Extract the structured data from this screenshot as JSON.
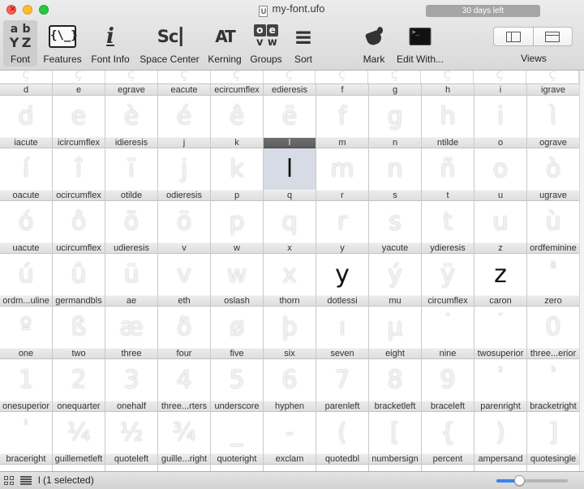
{
  "window": {
    "title": "my-font.ufo",
    "doc_icon": "U",
    "trial_badge": "30 days left"
  },
  "toolbar": {
    "font": {
      "label": "Font",
      "icon": "font-icon",
      "glyphs": [
        "a",
        "b",
        "Y",
        "Z"
      ]
    },
    "features": {
      "label": "Features",
      "icon": "features-icon",
      "glyph": "{\\_}"
    },
    "font_info": {
      "label": "Font Info",
      "icon": "info-icon",
      "glyph": "i"
    },
    "space_center": {
      "label": "Space Center",
      "icon": "space-center-icon",
      "glyph": "Sc"
    },
    "kerning": {
      "label": "Kerning",
      "icon": "kerning-icon",
      "glyph": "AT"
    },
    "groups": {
      "label": "Groups",
      "icon": "groups-icon",
      "glyphs": [
        "o",
        "e",
        "v",
        "w"
      ]
    },
    "sort": {
      "label": "Sort",
      "icon": "sort-icon",
      "glyph": "≡"
    },
    "mark": {
      "label": "Mark",
      "icon": "paint-bucket-icon"
    },
    "edit_with": {
      "label": "Edit With...",
      "icon": "terminal-icon",
      "glyph": ">_"
    },
    "views": {
      "label": "Views",
      "icon_left": "panel-left-icon",
      "icon_right": "panel-top-icon"
    }
  },
  "grid": {
    "colors": {
      "selected_header": "#666666",
      "selected_cell": "#d7dbe6",
      "slider_fill": "#3b82f0"
    },
    "top_strip": [
      "ç",
      "ç",
      "ç",
      "ç",
      "ç",
      "ç",
      "ç",
      "ç",
      "ç",
      "ç",
      "ç"
    ],
    "rows": [
      {
        "names": [
          "d",
          "e",
          "egrave",
          "eacute",
          "ecircumflex",
          "edieresis",
          "f",
          "g",
          "h",
          "i",
          "igrave"
        ],
        "glyphs": [
          "d",
          "e",
          "è",
          "é",
          "ê",
          "ë",
          "f",
          "g",
          "h",
          "i",
          "ì"
        ]
      },
      {
        "names": [
          "iacute",
          "icircumflex",
          "idieresis",
          "j",
          "k",
          "l",
          "m",
          "n",
          "ntilde",
          "o",
          "ograve"
        ],
        "glyphs": [
          "í",
          "î",
          "ï",
          "j",
          "k",
          "l",
          "m",
          "n",
          "ñ",
          "o",
          "ò"
        ]
      },
      {
        "names": [
          "oacute",
          "ocircumflex",
          "otilde",
          "odieresis",
          "p",
          "q",
          "r",
          "s",
          "t",
          "u",
          "ugrave"
        ],
        "glyphs": [
          "ó",
          "ô",
          "õ",
          "ö",
          "p",
          "q",
          "r",
          "s",
          "t",
          "u",
          "ù"
        ]
      },
      {
        "names": [
          "uacute",
          "ucircumflex",
          "udieresis",
          "v",
          "w",
          "x",
          "y",
          "yacute",
          "ydieresis",
          "z",
          "ordfeminine"
        ],
        "glyphs": [
          "ú",
          "û",
          "ü",
          "v",
          "w",
          "x",
          "y",
          "ý",
          "ÿ",
          "z",
          "ª"
        ]
      },
      {
        "names": [
          "ordm...uline",
          "germandbls",
          "ae",
          "eth",
          "oslash",
          "thorn",
          "dotlessi",
          "mu",
          "circumflex",
          "caron",
          "zero"
        ],
        "glyphs": [
          "º",
          "ß",
          "æ",
          "ð",
          "ø",
          "þ",
          "ı",
          "µ",
          "ˆ",
          "ˇ",
          "0"
        ]
      },
      {
        "names": [
          "one",
          "two",
          "three",
          "four",
          "five",
          "six",
          "seven",
          "eight",
          "nine",
          "twosuperior",
          "three...erior"
        ],
        "glyphs": [
          "1",
          "2",
          "3",
          "4",
          "5",
          "6",
          "7",
          "8",
          "9",
          "²",
          "³"
        ]
      },
      {
        "names": [
          "onesuperior",
          "onequarter",
          "onehalf",
          "three...rters",
          "underscore",
          "hyphen",
          "parenleft",
          "bracketleft",
          "braceleft",
          "parenright",
          "bracketright"
        ],
        "glyphs": [
          "¹",
          "¼",
          "½",
          "¾",
          "_",
          "-",
          "(",
          "[",
          "{",
          ")",
          "]"
        ]
      },
      {
        "names": [
          "braceright",
          "guillemetleft",
          "quoteleft",
          "guille...right",
          "quoteright",
          "exclam",
          "quotedbl",
          "numbersign",
          "percent",
          "ampersand",
          "quotesingle"
        ],
        "glyphs": [
          "}",
          "«",
          "‘",
          "»",
          "’",
          "!",
          "\"",
          "#",
          "%",
          "&",
          "'"
        ]
      }
    ],
    "selected_index": [
      1,
      5
    ],
    "filled_cells": [
      [
        1,
        5
      ],
      [
        3,
        6
      ],
      [
        3,
        9
      ]
    ],
    "small_cells": [
      [
        3,
        10
      ],
      [
        4,
        8
      ],
      [
        4,
        9
      ],
      [
        5,
        9
      ],
      [
        5,
        10
      ],
      [
        6,
        0
      ]
    ]
  },
  "status": {
    "selection_text": "l (1 selected)",
    "grid_view_icon": "grid-view-icon",
    "list_view_icon": "list-view-icon",
    "zoom_fraction": 0.32
  }
}
